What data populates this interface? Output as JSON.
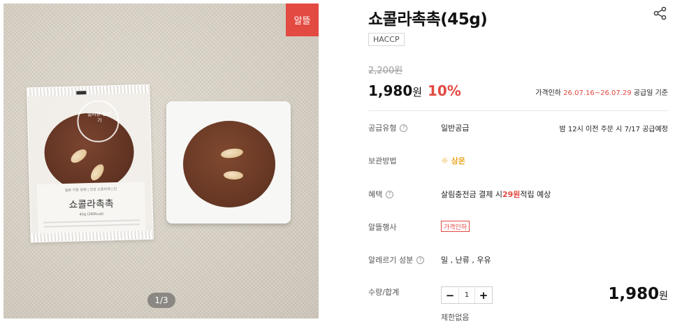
{
  "gallery": {
    "badge": "알뜰",
    "pager": "1/3",
    "package": {
      "logo_text": "일리몬 살리기",
      "label_top": "일본 가정 유래 | 건강 소용되게 | 인",
      "label_name": "쇼콜라촉촉",
      "label_weight": "45g (260kcal)"
    }
  },
  "product": {
    "title": "쇼콜라촉촉(45g)",
    "certification": "HACCP",
    "original_price": "2,200원",
    "price_number": "1,980",
    "price_unit": "원",
    "discount": "10%",
    "price_note_prefix": "가격인하 ",
    "price_note_dates": "26.07.16~26.07.29",
    "price_note_suffix": " 공급일 기준"
  },
  "info": {
    "supply_type": {
      "label": "공급유형",
      "value": "일반공급",
      "right": "밤 12시 이전 주문 시 7/17 공급예정"
    },
    "storage": {
      "label": "보관방법",
      "value": "상온"
    },
    "benefit": {
      "label": "혜택",
      "prefix": "살림충전금 결제 시 ",
      "amount": "29원",
      "suffix": " 적립 예상"
    },
    "event": {
      "label": "알뜰행사",
      "tag": "가격인하"
    },
    "allergy": {
      "label": "알레르기 성분",
      "value": "밀 , 난류 , 우유"
    },
    "quantity": {
      "label": "수량/합계",
      "minus": "−",
      "value": "1",
      "plus": "+",
      "limit": "제한없음"
    },
    "total_number": "1,980",
    "total_unit": "원"
  },
  "icons": {
    "share": "share-icon",
    "help": "help-circle-icon",
    "sun": "sun-icon"
  },
  "colors": {
    "accent": "#e24a42",
    "storage": "#e9a41e"
  }
}
